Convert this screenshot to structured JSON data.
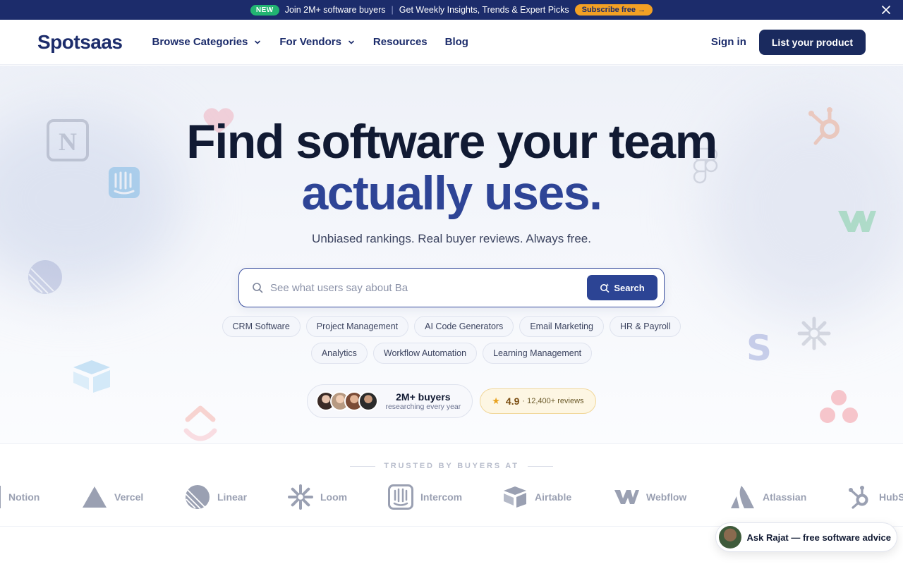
{
  "announcement": {
    "badge": "NEW",
    "text1": "Join 2M+ software buyers",
    "text2": "Get Weekly Insights, Trends & Expert Picks",
    "cta": "Subscribe free →"
  },
  "nav": {
    "logo": "Spotsaas",
    "items": [
      {
        "label": "Browse Categories",
        "dropdown": true
      },
      {
        "label": "For Vendors",
        "dropdown": true
      },
      {
        "label": "Resources",
        "dropdown": false
      },
      {
        "label": "Blog",
        "dropdown": false
      }
    ],
    "signin": "Sign in",
    "cta": "List your product"
  },
  "hero": {
    "title_line1": "Find software your team",
    "title_line2": "actually uses.",
    "subtitle": "Unbiased rankings. Real buyer reviews. Always free.",
    "search_placeholder": "See what users say about Ba",
    "search_button": "Search",
    "chips": [
      "CRM Software",
      "Project Management",
      "AI Code Generators",
      "Email Marketing",
      "HR & Payroll",
      "Analytics",
      "Workflow Automation",
      "Learning Management"
    ],
    "buyers_title": "2M+ buyers",
    "buyers_sub": "researching every year",
    "rating_score": "4.9",
    "rating_reviews": "· 12,400+ reviews"
  },
  "trusted": {
    "label": "TRUSTED BY BUYERS AT",
    "logos": [
      {
        "name": "Notion",
        "icon": "notion-icon"
      },
      {
        "name": "Vercel",
        "icon": "vercel-icon"
      },
      {
        "name": "Linear",
        "icon": "linear-icon"
      },
      {
        "name": "Loom",
        "icon": "loom-icon"
      },
      {
        "name": "Intercom",
        "icon": "intercom-icon"
      },
      {
        "name": "Airtable",
        "icon": "airtable-icon"
      },
      {
        "name": "Webflow",
        "icon": "webflow-icon"
      },
      {
        "name": "Atlassian",
        "icon": "atlassian-icon"
      },
      {
        "name": "HubS",
        "icon": "hubspot-icon"
      }
    ]
  },
  "chat": {
    "label": "Ask Rajat — free software advice"
  },
  "colors": {
    "brand_navy": "#1c2c6b",
    "accent_blue": "#2e4496",
    "badge_green": "#22b472",
    "subscribe_orange": "#f2a024"
  }
}
